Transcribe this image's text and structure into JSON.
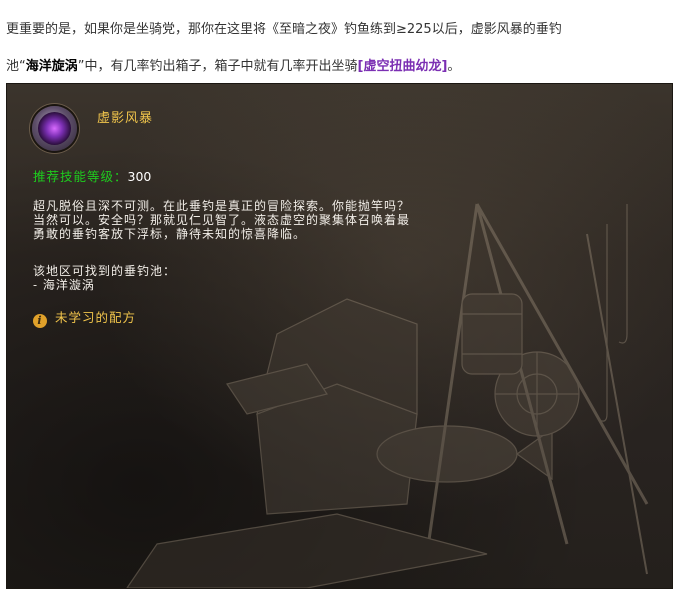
{
  "article": {
    "line1": "更重要的是，如果你是坐骑党，那你在这里将《至暗之夜》钓鱼练到≥225以后，虚影风暴的垂钓",
    "line2_prefix": "池“",
    "line2_pool": "海洋旋涡",
    "line2_mid": "”中，有几率钓出箱子，箱子中就有几率开出坐骑",
    "line2_mount": "[虚空扭曲幼龙]",
    "line2_suffix": "。"
  },
  "tooltip": {
    "title": "虚影风暴",
    "skill_label": "推荐技能等级：",
    "skill_value": "300",
    "description_lines": [
      "超凡脱俗且深不可测。在此垂钓是真正的冒险探索。你能抛竿吗？",
      "当然可以。安全吗？那就见仁见智了。液态虚空的聚集体召唤着最",
      "勇敢的垂钓客放下浮标，静待未知的惊喜降临。"
    ],
    "pools_label": "该地区可找到的垂钓池：",
    "pools_item": "- 海洋漩涡",
    "unlearned_label": "未学习的配方",
    "info_glyph": "i"
  },
  "colors": {
    "title_gold": "#f0c44b",
    "skill_green": "#1ecb1e",
    "mount_purple": "#7b2fb3"
  },
  "icons": {
    "zone_icon": "void-orb-icon",
    "info_icon": "info-icon"
  }
}
